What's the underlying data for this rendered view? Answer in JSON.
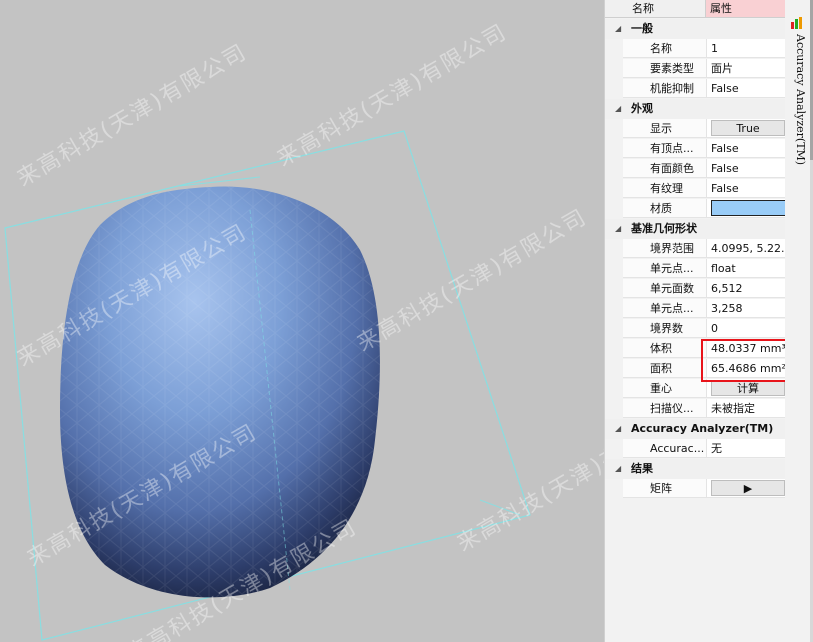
{
  "viewport": {
    "watermark": "来高科技(天津)有限公司"
  },
  "panel": {
    "header": {
      "name": "名称",
      "property": "属性"
    },
    "groups": [
      {
        "title": "一般",
        "rows": [
          {
            "name": "名称",
            "value": "1"
          },
          {
            "name": "要素类型",
            "value": "面片"
          },
          {
            "name": "机能抑制",
            "value": "False"
          }
        ]
      },
      {
        "title": "外观",
        "rows": [
          {
            "name": "显示",
            "value": "True"
          },
          {
            "name": "有顶点...",
            "value": "False"
          },
          {
            "name": "有面颜色",
            "value": "False"
          },
          {
            "name": "有纹理",
            "value": "False"
          },
          {
            "name": "材质",
            "value": ""
          }
        ]
      },
      {
        "title": "基准几何形状",
        "rows": [
          {
            "name": "境界范围",
            "value": "4.0995, 5.22..."
          },
          {
            "name": "单元点...",
            "value": "float"
          },
          {
            "name": "单元面数",
            "value": "6,512"
          },
          {
            "name": "单元点...",
            "value": "3,258"
          },
          {
            "name": "境界数",
            "value": "0"
          },
          {
            "name": "体积",
            "value": "48.0337 mm³"
          },
          {
            "name": "面积",
            "value": "65.4686 mm²"
          },
          {
            "name": "重心",
            "value": "计算"
          },
          {
            "name": "扫描仪...",
            "value": "未被指定"
          }
        ]
      },
      {
        "title": "Accuracy Analyzer(TM)",
        "rows": [
          {
            "name": "Accurac...",
            "value": "无"
          }
        ]
      },
      {
        "title": "结果",
        "rows": [
          {
            "name": "矩阵",
            "value": "▶"
          }
        ]
      }
    ],
    "colors": {
      "material": "#99ccf7",
      "highlight_box": "#e8141b",
      "header_property_bg": "#f9d0d3"
    }
  },
  "side_tab": {
    "label": "Accuracy Analyzer(TM)",
    "icon": "chart-icon"
  }
}
